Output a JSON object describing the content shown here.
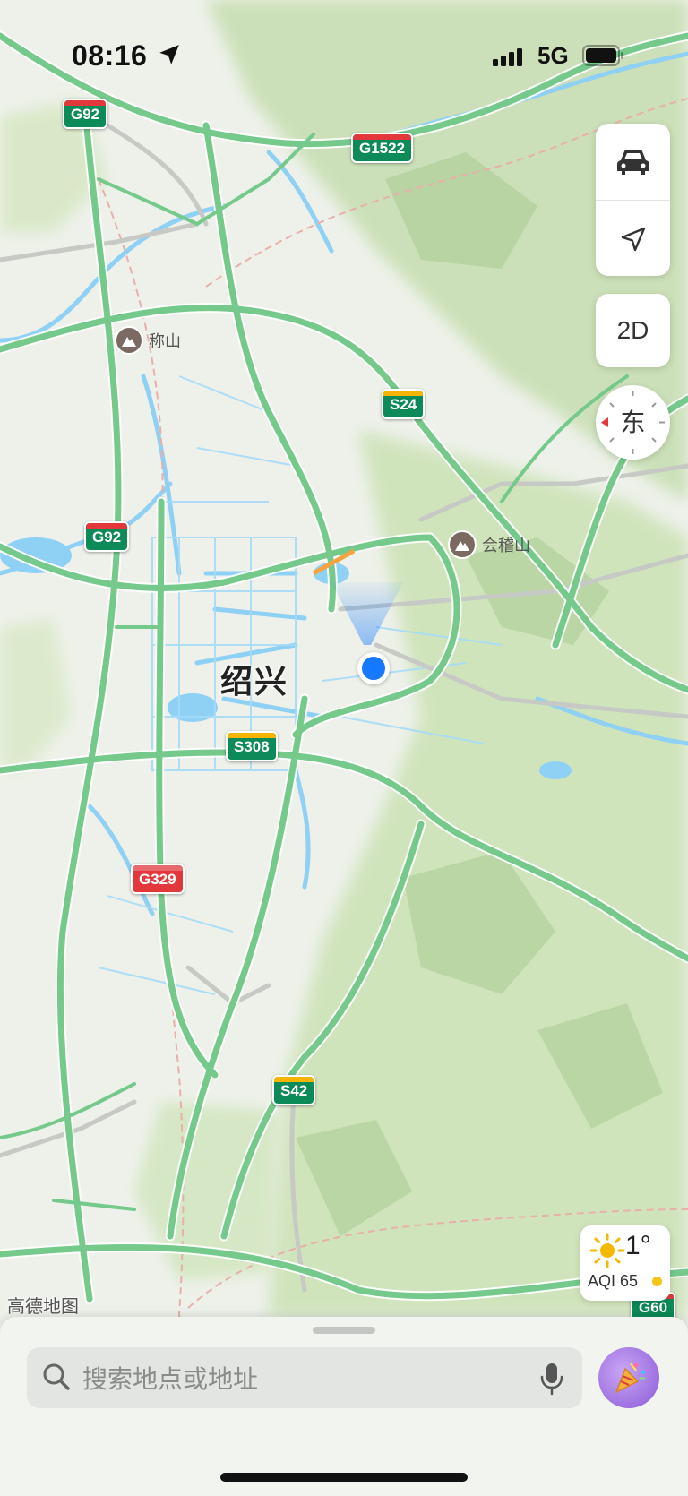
{
  "status_bar": {
    "time": "08:16",
    "network": "5G"
  },
  "map": {
    "city": "绍兴",
    "roads": [
      "G92",
      "G1522",
      "S24",
      "G92",
      "S308",
      "G329",
      "S42",
      "G60"
    ],
    "pois": [
      "称山",
      "会稽山"
    ],
    "watermark": "高德地图"
  },
  "controls": {
    "drive_icon": "car-icon",
    "locate_icon": "navigation-arrow-icon",
    "view_mode": "2D",
    "compass_direction": "东"
  },
  "weather": {
    "temp": "1°",
    "aqi": "AQI 65",
    "icon": "sun-icon",
    "aqi_color": "#f5c518"
  },
  "search": {
    "placeholder": "搜索地点或地址"
  },
  "colors": {
    "highway": "#74c98b",
    "water": "#8fd0f5",
    "accent": "#1479ff"
  }
}
